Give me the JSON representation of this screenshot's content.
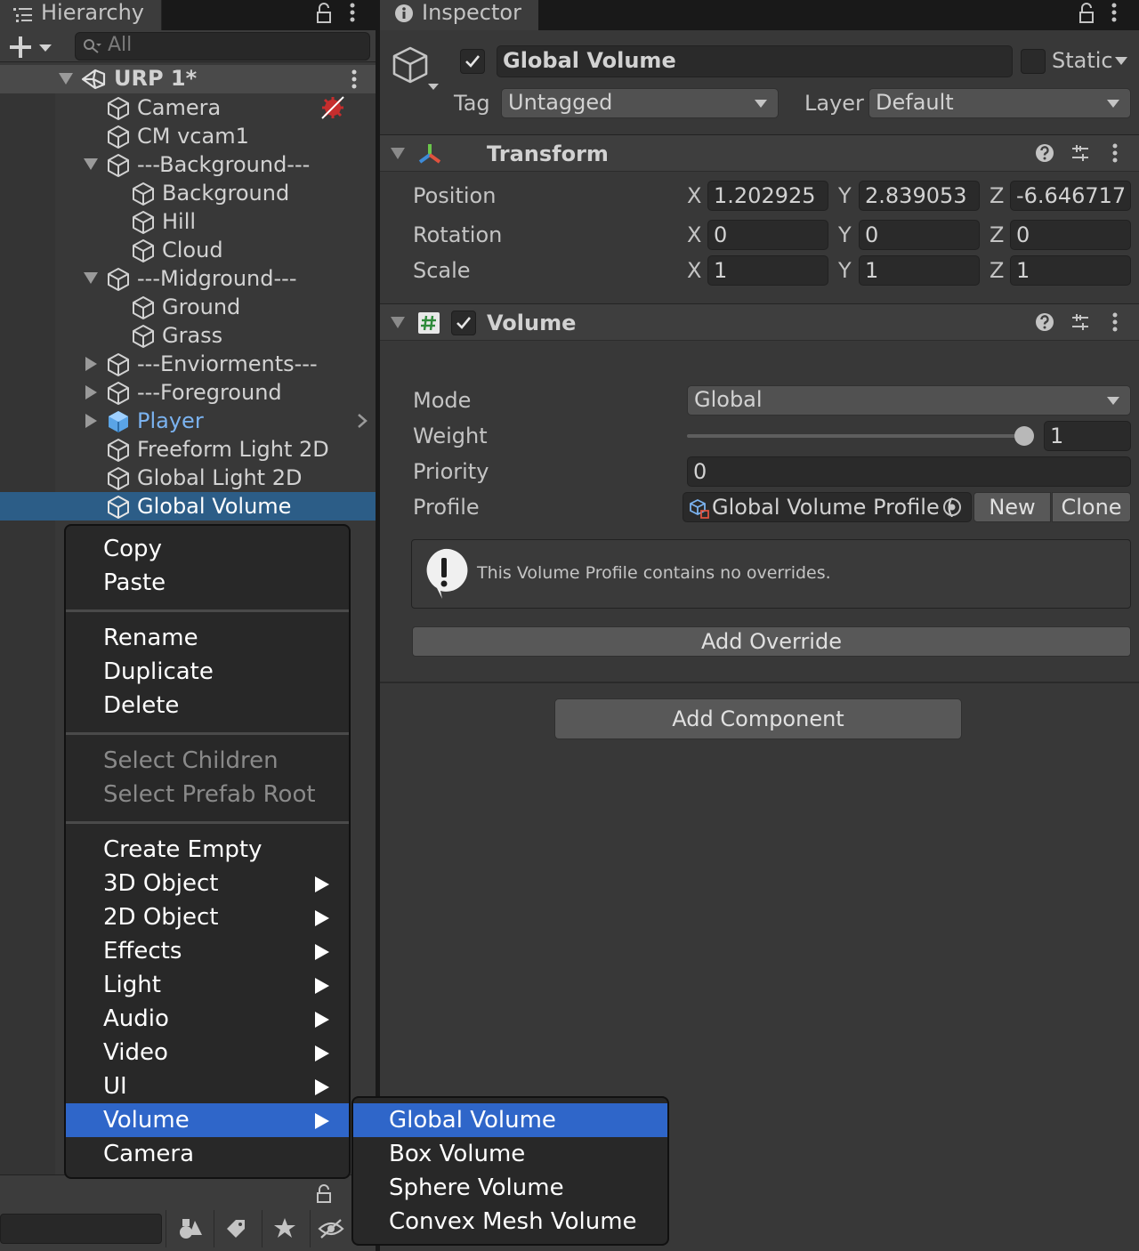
{
  "hierarchy": {
    "tab_label": "Hierarchy",
    "search_placeholder": "All",
    "scene_name": "URP 1*",
    "items": [
      {
        "label": "Camera"
      },
      {
        "label": "CM vcam1"
      },
      {
        "label": "---Background---"
      },
      {
        "label": "Background"
      },
      {
        "label": "Hill"
      },
      {
        "label": "Cloud"
      },
      {
        "label": "---Midground---"
      },
      {
        "label": "Ground"
      },
      {
        "label": "Grass"
      },
      {
        "label": "---Enviorments---"
      },
      {
        "label": "---Foreground"
      },
      {
        "label": "Player"
      },
      {
        "label": "Freeform Light 2D"
      },
      {
        "label": "Global Light 2D"
      },
      {
        "label": "Global Volume"
      }
    ]
  },
  "context_menu": {
    "group1": [
      "Copy",
      "Paste"
    ],
    "group2": [
      "Rename",
      "Duplicate",
      "Delete"
    ],
    "group3": [
      "Select Children",
      "Select Prefab Root"
    ],
    "group4": [
      "Create Empty",
      "3D Object",
      "2D Object",
      "Effects",
      "Light",
      "Audio",
      "Video",
      "UI",
      "Volume",
      "Camera"
    ]
  },
  "volume_submenu": [
    "Global Volume",
    "Box Volume",
    "Sphere Volume",
    "Convex Mesh Volume"
  ],
  "inspector": {
    "tab_label": "Inspector",
    "object_name": "Global Volume",
    "static_label": "Static",
    "tag_label": "Tag",
    "tag_value": "Untagged",
    "layer_label": "Layer",
    "layer_value": "Default",
    "transform": {
      "title": "Transform",
      "position_label": "Position",
      "rotation_label": "Rotation",
      "scale_label": "Scale",
      "position": {
        "x": "1.202925",
        "y": "2.839053",
        "z": "-6.646717"
      },
      "rotation": {
        "x": "0",
        "y": "0",
        "z": "0"
      },
      "scale": {
        "x": "1",
        "y": "1",
        "z": "1"
      },
      "axis_x": "X",
      "axis_y": "Y",
      "axis_z": "Z"
    },
    "volume": {
      "title": "Volume",
      "mode_label": "Mode",
      "mode_value": "Global",
      "weight_label": "Weight",
      "weight_value": "1",
      "priority_label": "Priority",
      "priority_value": "0",
      "profile_label": "Profile",
      "profile_value": "Global Volume Profile (",
      "new_button": "New",
      "clone_button": "Clone",
      "info_message": "This Volume Profile contains no overrides.",
      "add_override": "Add Override"
    },
    "add_component": "Add Component"
  },
  "colors": {
    "selection": "#2c5d87",
    "menu_highlight": "#2f66c9",
    "prefab_blue": "#7bb3f0"
  }
}
